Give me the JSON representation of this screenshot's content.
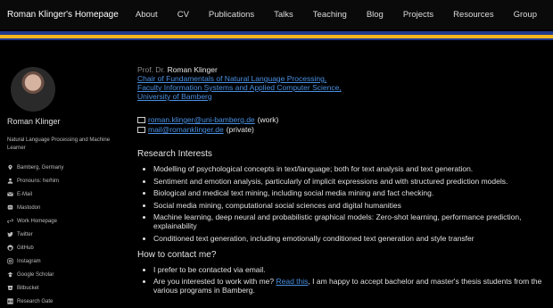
{
  "header": {
    "site_title": "Roman Klinger's Homepage",
    "nav": [
      "About",
      "CV",
      "Publications",
      "Talks",
      "Teaching",
      "Blog",
      "Projects",
      "Resources",
      "Group"
    ]
  },
  "colors": {
    "stripe_blue": "#1f3a8c",
    "stripe_yellow": "#f2b51e",
    "link": "#4a90e2"
  },
  "sidebar": {
    "name": "Roman Klinger",
    "bio": "Natural Language Processing and Machine Learner",
    "links": [
      {
        "icon": "map-marker-icon",
        "label": "Bamberg, Germany"
      },
      {
        "icon": "user-icon",
        "label": "Pronouns: he/him"
      },
      {
        "icon": "envelope-icon",
        "label": "E-Mail"
      },
      {
        "icon": "mastodon-icon",
        "label": "Mastodon"
      },
      {
        "icon": "link-icon",
        "label": "Work Homepage"
      },
      {
        "icon": "twitter-icon",
        "label": "Twitter"
      },
      {
        "icon": "github-icon",
        "label": "GitHub"
      },
      {
        "icon": "instagram-icon",
        "label": "Instagram"
      },
      {
        "icon": "google-scholar-icon",
        "label": "Google Scholar"
      },
      {
        "icon": "bitbucket-icon",
        "label": "Bitbucket"
      },
      {
        "icon": "researchgate-icon",
        "label": "Research Gate"
      }
    ]
  },
  "main": {
    "prefix": "Prof. Dr.",
    "name": "Roman Klinger",
    "affiliations": [
      "Chair of Fundamentals of Natural Language Processing,",
      "Faculty Information Systems and Applied Computer Science,",
      "University of Bamberg"
    ],
    "emails": [
      {
        "address": "roman.klinger@uni-bamberg.de",
        "note": "(work)"
      },
      {
        "address": "mail@romanklinger.de",
        "note": "(private)"
      }
    ],
    "research_heading": "Research Interests",
    "research_items": [
      "Modelling of psychological concepts in text/language; both for text analysis and text generation.",
      "Sentiment and emotion analysis, particularly of implicit expressions and with structured prediction models.",
      "Biological and medical text mining, including social media mining and fact checking.",
      "Social media mining, computational social sciences and digital humanities",
      "Machine learning, deep neural and probabilistic graphical models: Zero-shot learning, performance prediction, explainability",
      "Conditioned text generation, including emotionally conditioned text generation and style transfer"
    ],
    "contact_heading": "How to contact me?",
    "contact_items": {
      "item1": "I prefer to be contacted via email.",
      "item2_pre": "Are you interested to work with me?",
      "item2_link": "Read this",
      "item2_post": ", I am happy to accept bachelor and master's thesis students from the various programs in Bamberg."
    }
  }
}
